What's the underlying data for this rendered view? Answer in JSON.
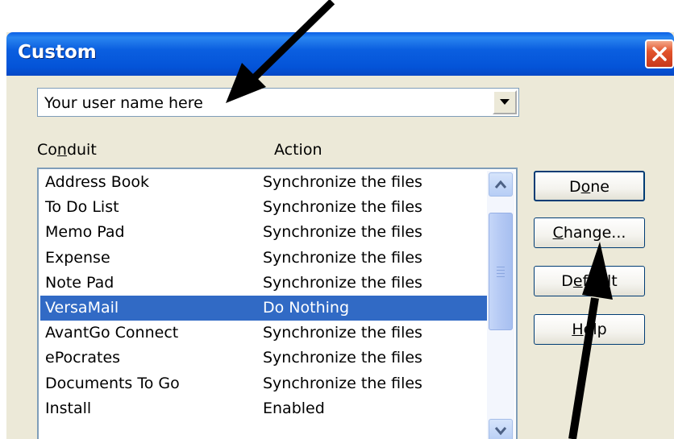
{
  "window": {
    "title": "Custom",
    "close_icon": "close-x-icon"
  },
  "user_combo": {
    "value": "Your user name here"
  },
  "columns": {
    "conduit": "Conduit",
    "action": "Action"
  },
  "conduits": [
    {
      "name": "Address Book",
      "action": "Synchronize the files",
      "selected": false
    },
    {
      "name": "To Do List",
      "action": "Synchronize the files",
      "selected": false
    },
    {
      "name": "Memo Pad",
      "action": "Synchronize the files",
      "selected": false
    },
    {
      "name": "Expense",
      "action": "Synchronize the files",
      "selected": false
    },
    {
      "name": "Note Pad",
      "action": "Synchronize the files",
      "selected": false
    },
    {
      "name": "VersaMail",
      "action": "Do Nothing",
      "selected": true
    },
    {
      "name": "AvantGo Connect",
      "action": "Synchronize the files",
      "selected": false
    },
    {
      "name": "ePocrates",
      "action": "Synchronize the files",
      "selected": false
    },
    {
      "name": "Documents To Go",
      "action": "Synchronize the files",
      "selected": false
    },
    {
      "name": "Install",
      "action": "Enabled",
      "selected": false
    }
  ],
  "buttons": {
    "done": "Done",
    "change": "Change...",
    "default": "Default",
    "help": "Help"
  },
  "colors": {
    "titlebar": "#0454d8",
    "selection": "#316ac5",
    "dialog_bg": "#ece9d8"
  }
}
